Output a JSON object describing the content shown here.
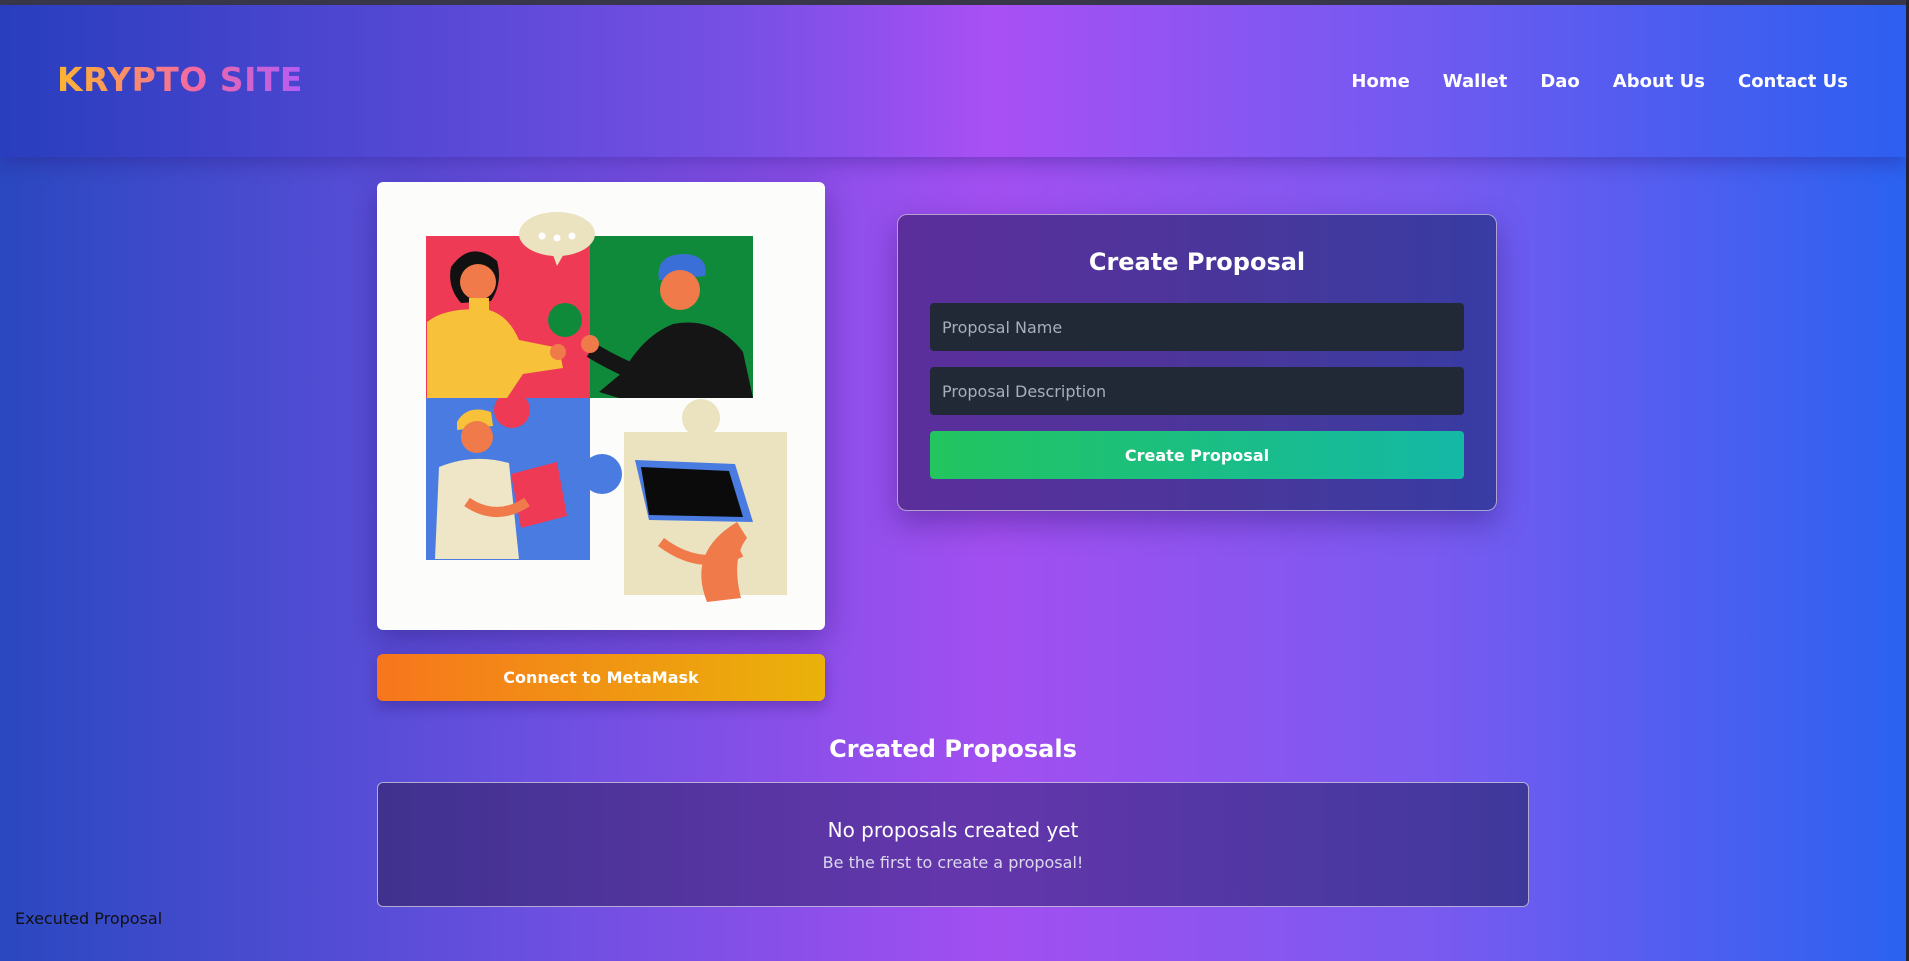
{
  "header": {
    "logo": "KRYPTO SITE",
    "nav": [
      "Home",
      "Wallet",
      "Dao",
      "About Us",
      "Contact Us"
    ]
  },
  "hero": {
    "illustration": "team-puzzle-illustration",
    "connect_label": "Connect to MetaMask"
  },
  "create_proposal": {
    "title": "Create Proposal",
    "name_placeholder": "Proposal Name",
    "name_value": "",
    "description_placeholder": "Proposal Description",
    "description_value": "",
    "submit_label": "Create Proposal"
  },
  "created": {
    "title": "Created Proposals",
    "empty_title": "No proposals created yet",
    "empty_subtitle": "Be the first to create a proposal!"
  },
  "footer": {
    "executed_label": "Executed Proposal"
  },
  "colors": {
    "metamask_start": "#f7761c",
    "metamask_end": "#eab20a",
    "create_start": "#22c55e",
    "create_end": "#14b8a6",
    "input_bg": "#212836"
  }
}
